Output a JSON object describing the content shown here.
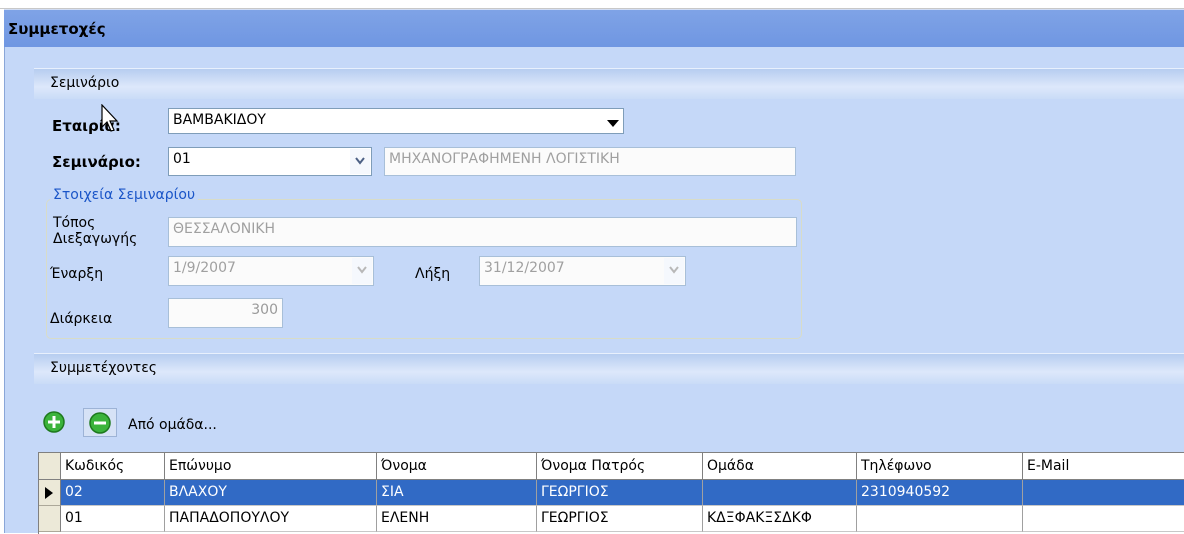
{
  "window": {
    "title": "Συμμετοχές"
  },
  "seminar_section": {
    "title": "Σεμινάριο"
  },
  "company": {
    "label": "Εταιρία:",
    "value": "ΒΑΜΒΑΚΙΔΟΥ"
  },
  "seminar": {
    "label": "Σεμινάριο:",
    "code": "01",
    "name": "ΜΗΧΑΝΟΓΡΑΦΗΜΕΝΗ ΛΟΓΙΣΤΙΚΗ"
  },
  "details": {
    "title": "Στοιχεία Σεμιναρίου",
    "place_label_1": "Τόπος",
    "place_label_2": "Διεξαγωγής",
    "place_value": "ΘΕΣΣΑΛΟΝΙΚΗ",
    "start_label": "Έναρξη",
    "start_value": "1/9/2007",
    "end_label": "Λήξη",
    "end_value": "31/12/2007",
    "duration_label": "Διάρκεια",
    "duration_value": "300"
  },
  "participants_section": {
    "title": "Συμμετέχοντες"
  },
  "toolbar": {
    "add_icon": "plus-circle-icon",
    "remove_icon": "minus-circle-icon",
    "from_group_label": "Από ομάδα..."
  },
  "grid": {
    "columns": [
      "Κωδικός",
      "Επώνυμο",
      "Όνομα",
      "Όνομα Πατρός",
      "Ομάδα",
      "Τηλέφωνο",
      "E-Mail"
    ],
    "rows": [
      [
        "02",
        "ΒΛΑΧΟΥ",
        "ΣΙΑ",
        "ΓΕΩΡΓΙΟΣ",
        "",
        "2310940592",
        ""
      ],
      [
        "01",
        "ΠΑΠΑΔΟΠΟΥΛΟΥ",
        "ΕΛΕΝΗ",
        "ΓΕΩΡΓΙΟΣ",
        "ΚΔΞΦΑΚΞΣΔΚΦ",
        "",
        ""
      ]
    ],
    "selected_row": 0
  },
  "colors": {
    "titlebar": "#7fa3e6",
    "form_bg": "#c5d8f8",
    "selection": "#316ac5",
    "group_title": "#1a55c8"
  }
}
